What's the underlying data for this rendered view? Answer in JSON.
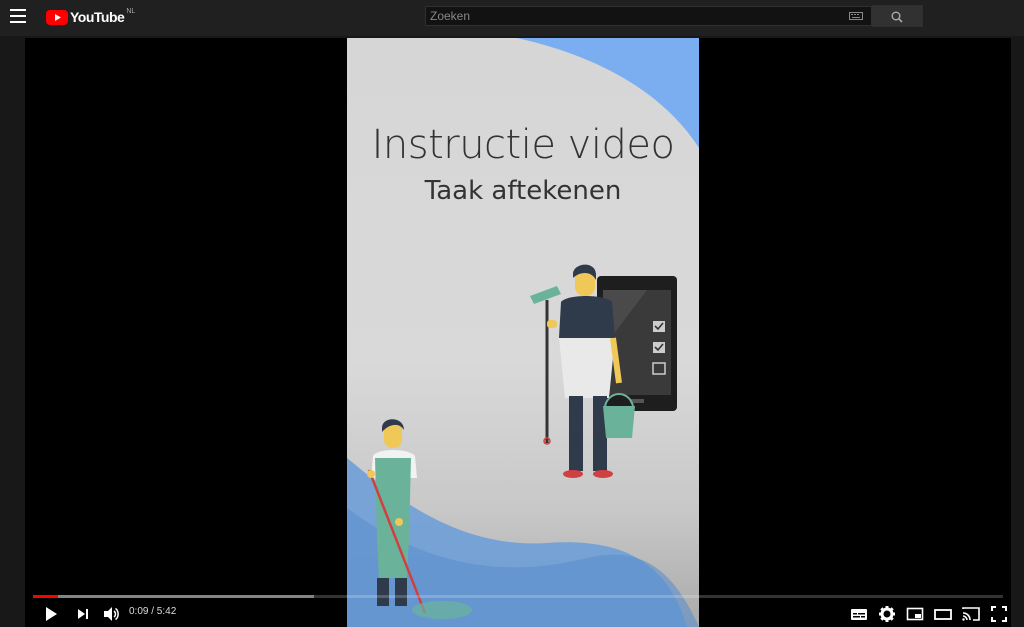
{
  "masthead": {
    "logo_text": "YouTube",
    "country_code": "NL",
    "search": {
      "placeholder": "Zoeken",
      "value": ""
    }
  },
  "video": {
    "title": "Instructie video",
    "subtitle": "Taak aftekenen"
  },
  "player": {
    "current_time": "0:09",
    "duration": "5:42",
    "time_display": "0:09 / 5:42",
    "played_fraction": 0.026,
    "loaded_fraction": 0.29
  },
  "colors": {
    "progress_played": "#ff0000",
    "brand_red": "#ff0000",
    "wave_blue": "#7aaef0"
  },
  "icons": {
    "menu": "menu-icon",
    "keyboard": "keyboard-icon",
    "search": "search-icon",
    "play": "play-icon",
    "next": "next-icon",
    "volume": "volume-icon",
    "subtitles": "subtitles-icon",
    "settings": "settings-icon",
    "miniplayer": "miniplayer-icon",
    "theater": "theater-icon",
    "cast": "cast-icon",
    "fullscreen": "fullscreen-icon"
  }
}
